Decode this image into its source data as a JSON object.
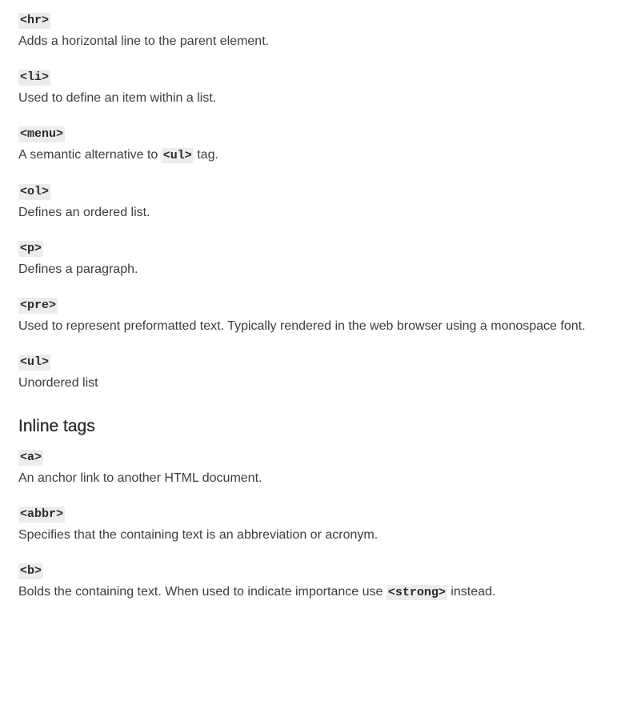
{
  "block_entries": [
    {
      "tag": "<hr>",
      "desc": "Adds a horizontal line to the parent element."
    },
    {
      "tag": "<li>",
      "desc": "Used to define an item within a list."
    },
    {
      "tag": "<menu>",
      "desc_before": "A semantic alternative to ",
      "code": "<ul>",
      "desc_after": " tag."
    },
    {
      "tag": "<ol>",
      "desc": "Defines an ordered list."
    },
    {
      "tag": "<p>",
      "desc": "Defines a paragraph."
    },
    {
      "tag": "<pre>",
      "desc": "Used to represent preformatted text. Typically rendered in the web browser using a monospace font."
    },
    {
      "tag": "<ul>",
      "desc": "Unordered list"
    }
  ],
  "inline_section": {
    "heading": "Inline tags",
    "entries": [
      {
        "tag": "<a>",
        "desc": "An anchor link to another HTML document."
      },
      {
        "tag": "<abbr>",
        "desc": "Specifies that the containing text is an abbreviation or acronym."
      },
      {
        "tag": "<b>",
        "desc_before": "Bolds the containing text. When used to indicate importance use ",
        "code": "<strong>",
        "desc_after": " instead."
      }
    ]
  }
}
